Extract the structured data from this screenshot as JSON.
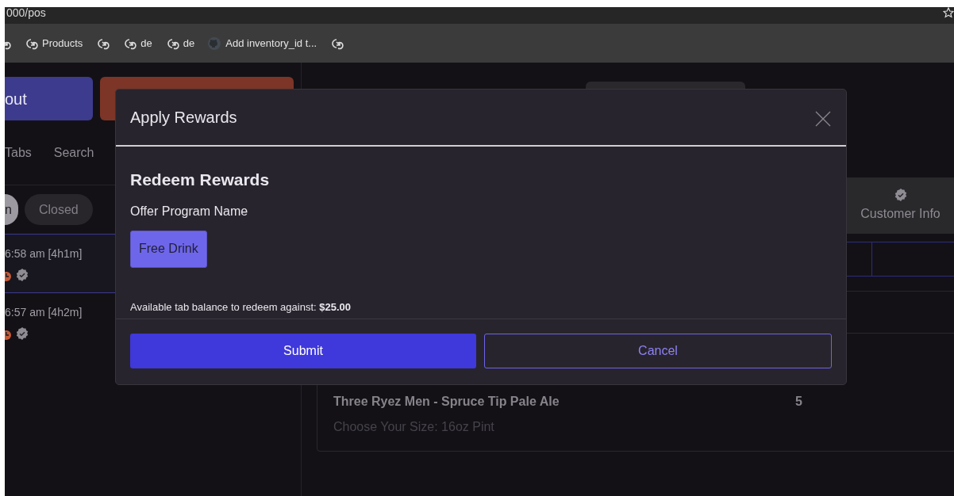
{
  "browser": {
    "url": "000/pos",
    "bookmarks": [
      {
        "kind": "link"
      },
      {
        "kind": "link",
        "label": "Products"
      },
      {
        "kind": "link"
      },
      {
        "kind": "link",
        "label": "de"
      },
      {
        "kind": "link",
        "label": "de"
      },
      {
        "kind": "github",
        "label": "Add inventory_id t..."
      },
      {
        "kind": "link"
      }
    ]
  },
  "left_panel": {
    "actions": [
      {
        "kind": "primary",
        "label": "out"
      },
      {
        "kind": "danger"
      }
    ],
    "tabs": [
      "Tabs",
      "Search"
    ],
    "filters": [
      {
        "label": "n",
        "selected": true
      },
      {
        "label": "Closed",
        "selected": false
      }
    ],
    "open_tabs": [
      {
        "time": "6:58 am [4h1m]",
        "selected": true
      },
      {
        "time": "6:57 am [4h2m]",
        "selected": false
      }
    ]
  },
  "right_panel": {
    "nav_tab": "Customer Info",
    "order_item": {
      "name": "Three Ryez Men - Spruce Tip Pale Ale",
      "quantity": "5",
      "option": "Choose Your Size: 16oz Pint"
    }
  },
  "modal": {
    "title": "Apply Rewards",
    "section_title": "Redeem Rewards",
    "field_label": "Offer Program Name",
    "offers": [
      {
        "label": "Free Drink",
        "selected": true
      }
    ],
    "balance_text": "Available tab balance to redeem against: **$25.00**",
    "buttons": [
      {
        "kind": "submit",
        "label": "Submit"
      },
      {
        "kind": "cancel",
        "label": "Cancel"
      }
    ]
  }
}
